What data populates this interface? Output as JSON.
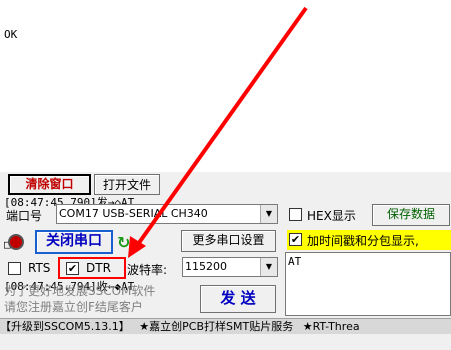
{
  "log": {
    "lines": [
      "OK",
      "",
      "",
      "",
      "[08:47:45.790]发→◇AT",
      "□",
      "[08:47:45.794]收←◆AT",
      "OK"
    ]
  },
  "toolbar": {
    "clear_label": "清除窗口",
    "open_file_label": "打开文件"
  },
  "port": {
    "label": "端口号",
    "value": "COM17 USB-SERIAL CH340",
    "close_button": "关闭串口",
    "more_settings": "更多串口设置",
    "rts_label": "RTS",
    "dtr_label": "DTR",
    "dtr_checked": true,
    "baud_label": "波特率:",
    "baud_value": "115200"
  },
  "right_panel": {
    "hex_label": "HEX显示",
    "save_label": "保存数据",
    "timestamp_label": "加时间戳和分包显示,",
    "timestamp_checked": true,
    "send_text": "AT"
  },
  "promo": {
    "line1": "为了更好地发展SSCOM软件",
    "line2": "请您注册嘉立创F结尾客户"
  },
  "send_button": "发 送",
  "status_bar": {
    "items": [
      "【升级到SSCOM5.13.1】",
      "★嘉立创PCB打样SMT贴片服务",
      "★RT-Threa"
    ]
  },
  "colors": {
    "highlight": "#ff0000",
    "timestamp_bg": "#ffff00",
    "close_button_border": "#0000ff"
  }
}
